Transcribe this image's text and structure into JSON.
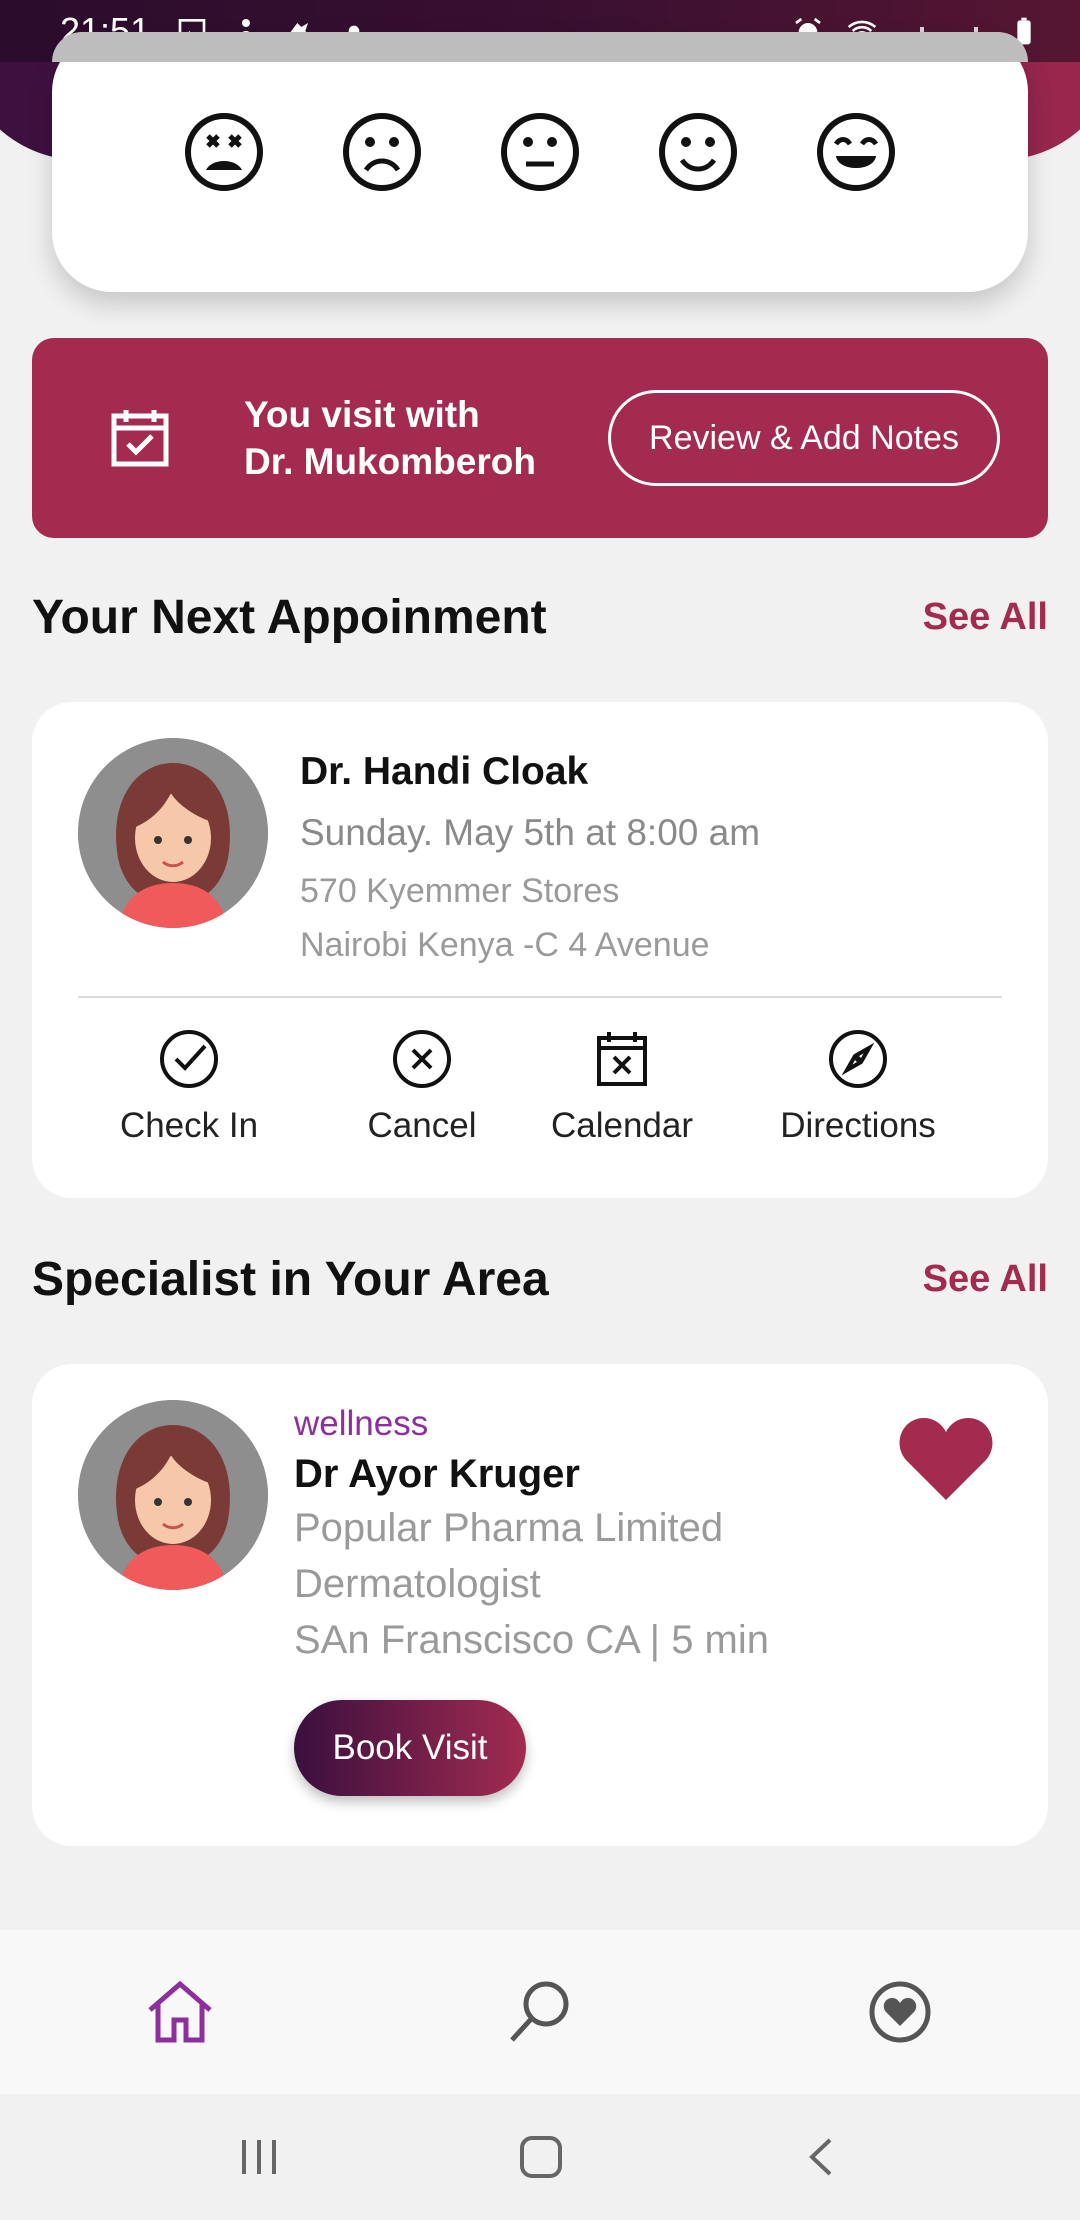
{
  "status_bar": {
    "time": "21:51",
    "left_icons": [
      "image-icon",
      "person-icon",
      "hand-icon",
      "dot-icon"
    ],
    "right_icons": [
      "alarm-icon",
      "wifi-icon",
      "signal-icon",
      "signal-icon",
      "battery-icon"
    ]
  },
  "mood": {
    "options": [
      "very-sad",
      "sad",
      "neutral",
      "happy",
      "very-happy"
    ]
  },
  "visit_banner": {
    "line1": "You visit with",
    "line2": "Dr. Mukomberoh",
    "button": "Review & Add Notes"
  },
  "next_appointment": {
    "title": "Your Next Appoinment",
    "see_all": "See All",
    "doctor": "Dr. Handi Cloak",
    "date": "Sunday. May 5th at 8:00 am",
    "address1": "570 Kyemmer Stores",
    "address2": "Nairobi Kenya -C 4 Avenue",
    "actions": [
      "Check In",
      "Cancel",
      "Calendar",
      "Directions"
    ]
  },
  "specialists": {
    "title": "Specialist in Your Area",
    "see_all": "See All",
    "tag": "wellness",
    "name": "Dr Ayor Kruger",
    "company": "Popular Pharma Limited",
    "specialty": "Dermatologist",
    "location": "SAn Franscisco CA | 5 min",
    "book": "Book Visit"
  },
  "colors": {
    "brand": "#a32b50",
    "brand_dark": "#3a0f3e",
    "accent_purple": "#8e2f9e"
  }
}
